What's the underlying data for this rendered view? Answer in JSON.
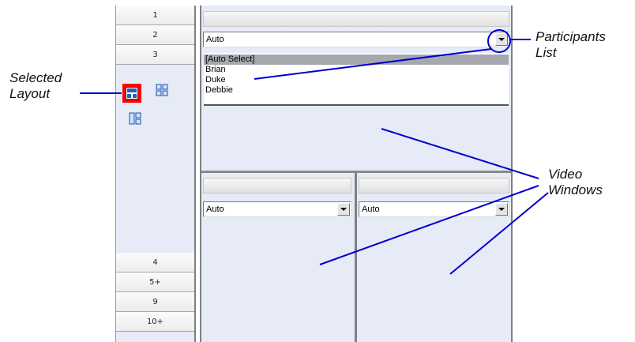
{
  "sidebar": {
    "top_tabs": [
      "1",
      "2",
      "3"
    ],
    "bottom_tabs": [
      "4",
      "5+",
      "9",
      "10+"
    ],
    "layout_icons": [
      "layout-2x1-icon",
      "layout-2x2-icon",
      "layout-3panel-icon"
    ],
    "selected_layout_color": "#ff0000"
  },
  "main_window": {
    "mode_select": "Auto",
    "participants": [
      "[Auto Select]",
      "Brian",
      "Duke",
      "Debbie"
    ],
    "selected_participant": "[Auto Select]",
    "bottom_left_select": "Auto",
    "bottom_right_select": "Auto"
  },
  "annotations": {
    "selected_layout": [
      "Selected",
      "Layout"
    ],
    "participants_list": [
      "Participants",
      "List"
    ],
    "video_windows": [
      "Video",
      "Windows"
    ]
  },
  "colors": {
    "panel_background": "#e6ebf7",
    "annotation_line": "#0000cc"
  }
}
